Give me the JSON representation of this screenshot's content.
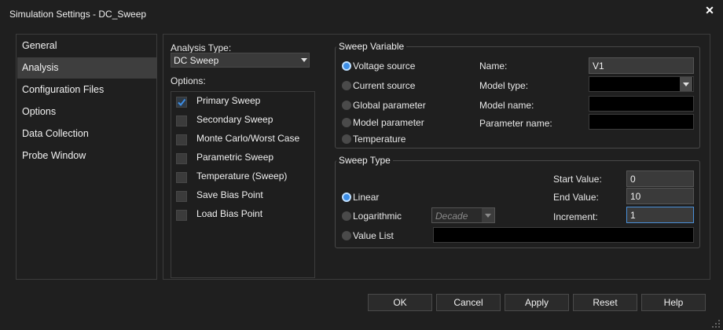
{
  "window": {
    "title": "Simulation Settings - DC_Sweep",
    "close_icon": "close-icon"
  },
  "nav": {
    "items": [
      {
        "label": "General",
        "selected": false
      },
      {
        "label": "Analysis",
        "selected": true
      },
      {
        "label": "Configuration Files",
        "selected": false
      },
      {
        "label": "Options",
        "selected": false
      },
      {
        "label": "Data Collection",
        "selected": false
      },
      {
        "label": "Probe Window",
        "selected": false
      }
    ]
  },
  "analysis": {
    "type_label": "Analysis Type:",
    "type_value": "DC Sweep",
    "options_label": "Options:",
    "options": [
      {
        "label": "Primary Sweep",
        "checked": true
      },
      {
        "label": "Secondary Sweep",
        "checked": false
      },
      {
        "label": "Monte Carlo/Worst Case",
        "checked": false
      },
      {
        "label": "Parametric Sweep",
        "checked": false
      },
      {
        "label": "Temperature (Sweep)",
        "checked": false
      },
      {
        "label": "Save Bias Point",
        "checked": false
      },
      {
        "label": "Load Bias Point",
        "checked": false
      }
    ]
  },
  "sweep_variable": {
    "title": "Sweep Variable",
    "options": [
      {
        "label": "Voltage source",
        "selected": true
      },
      {
        "label": "Current source",
        "selected": false
      },
      {
        "label": "Global parameter",
        "selected": false
      },
      {
        "label": "Model parameter",
        "selected": false
      },
      {
        "label": "Temperature",
        "selected": false
      }
    ],
    "name_label": "Name:",
    "name_value": "V1",
    "model_type_label": "Model type:",
    "model_type_value": "",
    "model_name_label": "Model name:",
    "model_name_value": "",
    "parameter_name_label": "Parameter name:",
    "parameter_name_value": ""
  },
  "sweep_type": {
    "title": "Sweep Type",
    "options": [
      {
        "label": "Linear",
        "selected": true
      },
      {
        "label": "Logarithmic",
        "selected": false
      },
      {
        "label": "Value List",
        "selected": false
      }
    ],
    "log_scale_value": "Decade",
    "value_list_value": "",
    "start_label": "Start Value:",
    "start_value": "0",
    "end_label": "End Value:",
    "end_value": "10",
    "increment_label": "Increment:",
    "increment_value": "1"
  },
  "buttons": {
    "ok": "OK",
    "cancel": "Cancel",
    "apply": "Apply",
    "reset": "Reset",
    "help": "Help"
  },
  "colors": {
    "accent": "#3d8ee6",
    "background": "#1f1f1f",
    "field": "#3a3a3a"
  }
}
